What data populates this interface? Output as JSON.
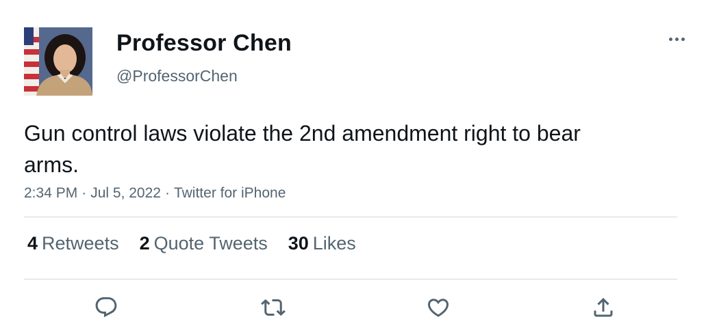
{
  "author": {
    "display_name": "Professor Chen",
    "handle": "@ProfessorChen",
    "avatar_icon": "profile-photo"
  },
  "tweet": {
    "text": "Gun control laws violate the 2nd amendment right to bear arms.",
    "time": "2:34 PM",
    "date": "Jul 5, 2022",
    "source": "Twitter for iPhone",
    "separator": "·"
  },
  "stats": {
    "retweets": {
      "count": "4",
      "label": "Retweets"
    },
    "quote_tweets": {
      "count": "2",
      "label": "Quote Tweets"
    },
    "likes": {
      "count": "30",
      "label": "Likes"
    }
  },
  "actions": {
    "reply_icon": "reply-icon",
    "retweet_icon": "retweet-icon",
    "like_icon": "heart-icon",
    "share_icon": "share-icon",
    "more_icon": "more-options-icon"
  },
  "colors": {
    "text_primary": "#0f1419",
    "text_secondary": "#536471",
    "divider": "#cfd9de"
  }
}
